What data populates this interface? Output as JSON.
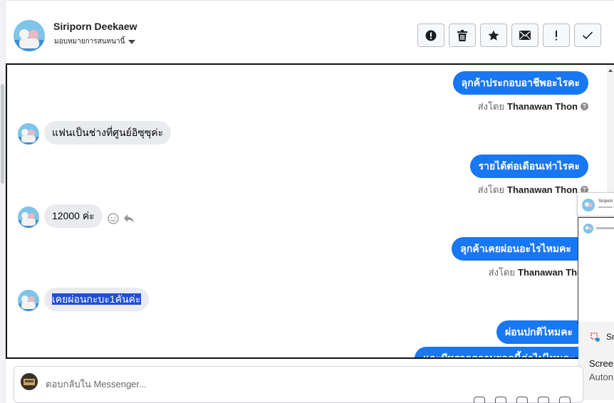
{
  "header": {
    "name": "Siriporn Deekaew",
    "assign_label": "มอบหมายการสนทนานี้",
    "actions": [
      {
        "name": "report-spam-button",
        "icon": "exclamation-circle-icon"
      },
      {
        "name": "delete-button",
        "icon": "trash-icon"
      },
      {
        "name": "star-button",
        "icon": "star-icon"
      },
      {
        "name": "mark-unread-button",
        "icon": "envelope-icon"
      },
      {
        "name": "follow-up-button",
        "icon": "exclamation-icon"
      },
      {
        "name": "mark-done-button",
        "icon": "check-icon"
      }
    ]
  },
  "messages": [
    {
      "dir": "out",
      "text": "ลุกค้าประกอบอาชีพอะไรคะ",
      "sent_by_label": "ส่งโดย",
      "sender": "Thanawan Thon"
    },
    {
      "dir": "in",
      "text": "แฟนเป็นช่างที่ศูนย์อิซุซุค่ะ"
    },
    {
      "dir": "out",
      "text": "รายได้ต่อเดือนเท่าไรคะ",
      "sent_by_label": "ส่งโดย",
      "sender": "Thanawan Thon"
    },
    {
      "dir": "in",
      "text": "12000 ค่ะ"
    },
    {
      "dir": "out",
      "text": "ลุกค้าเคยผ่อนอะไรไหมคะ",
      "sent_by_label": "ส่งโดย",
      "sender": "Thanawan Thon"
    },
    {
      "dir": "in",
      "text": "เคยผ่อนกะบะ1คันค่ะ",
      "selected": true
    },
    {
      "dir": "out",
      "text": "ผ่อนปกติไหมคะ"
    },
    {
      "dir": "out",
      "text": "และมีหรอกความยอดนี้ค่าไปไหมคะ"
    }
  ],
  "overlay": {
    "mini_title": "Siripom",
    "toast_title": "Sn",
    "toast_line1": "Screen",
    "toast_line2": "Auton"
  },
  "composer": {
    "placeholder": "ตอบกลับใน Messenger..."
  },
  "colors": {
    "outgoing_bubble": "#1877f2",
    "incoming_bubble": "#e9ebee",
    "selection": "#1f4fd1"
  }
}
